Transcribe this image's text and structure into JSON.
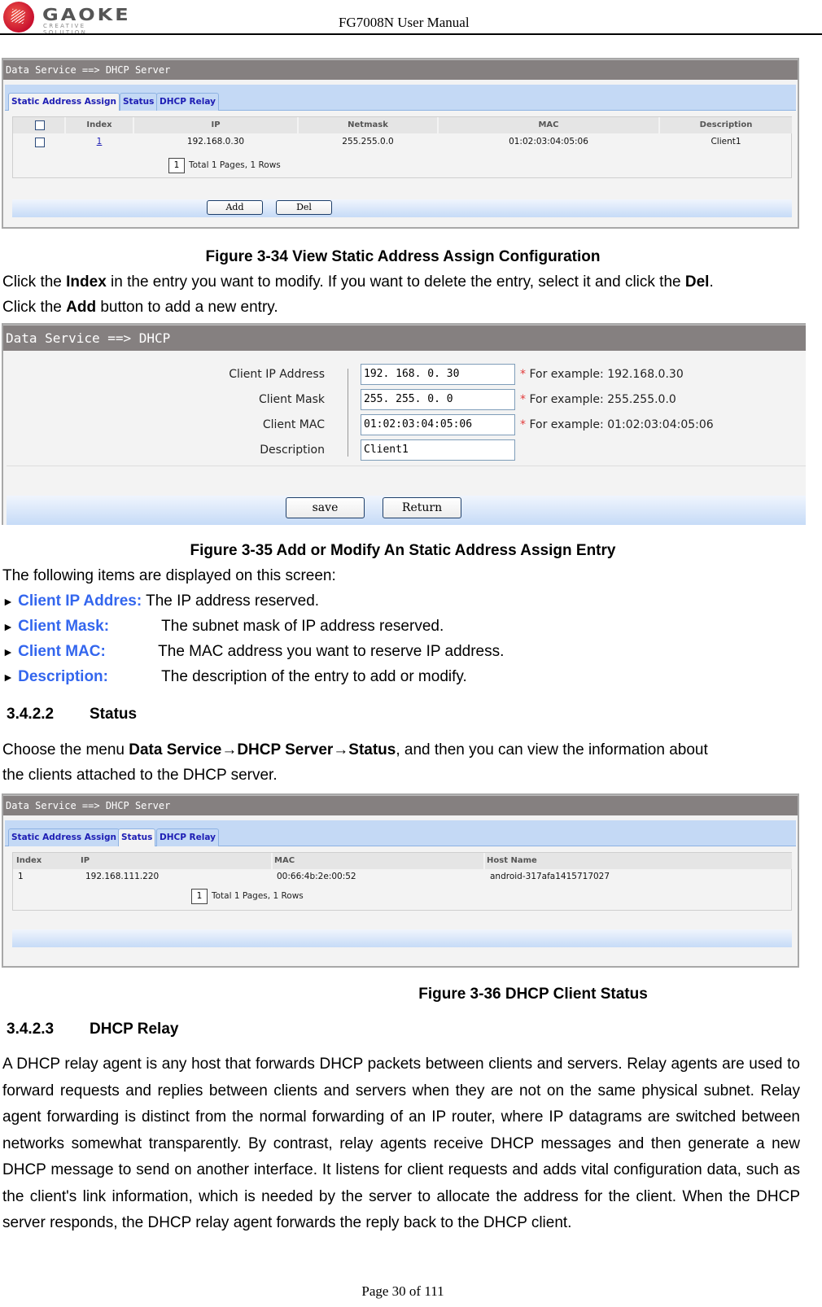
{
  "header": {
    "logo_word": "GAOKE",
    "logo_tagline": "CREATIVE SOLUTION",
    "doc_title": "FG7008N User Manual"
  },
  "fig34": {
    "title": "Data Service ==> DHCP Server",
    "tabs": [
      {
        "label": "Static Address Assign",
        "active": true
      },
      {
        "label": "Status",
        "active": false
      },
      {
        "label": "DHCP Relay",
        "active": false
      }
    ],
    "columns": [
      "Index",
      "IP",
      "Netmask",
      "MAC",
      "Description"
    ],
    "rows": [
      {
        "index": "1",
        "ip": "192.168.0.30",
        "netmask": "255.255.0.0",
        "mac": "01:02:03:04:05:06",
        "description": "Client1"
      }
    ],
    "pager_page": "1",
    "pager_text": "Total 1 Pages, 1 Rows",
    "add_label": "Add",
    "del_label": "Del",
    "caption": "Figure 3-34   View Static Address Assign Configuration"
  },
  "text1": {
    "line1_pre": "Click the ",
    "line1_b1": "Index",
    "line1_mid": " in the entry you want to modify. If you want to delete the entry, select it and click the ",
    "line1_b2": "Del",
    "line1_end": ".",
    "line2_pre": "Click the ",
    "line2_b": "Add",
    "line2_end": " button to add a new entry."
  },
  "fig35": {
    "title": "Data Service ==> DHCP",
    "fields": [
      {
        "label": "Client IP Address",
        "value": "192. 168. 0. 30",
        "hint": "For example: 192.168.0.30",
        "required": "*"
      },
      {
        "label": "Client Mask",
        "value": "255. 255. 0. 0",
        "hint": "For example: 255.255.0.0",
        "required": "*"
      },
      {
        "label": "Client MAC",
        "value": "01:02:03:04:05:06",
        "hint": "For example: 01:02:03:04:05:06",
        "required": "*"
      },
      {
        "label": "Description",
        "value": "Client1",
        "hint": "",
        "required": ""
      }
    ],
    "save_label": "save",
    "return_label": "Return",
    "caption": "Figure 3-35   Add or Modify An Static Address Assign Entry"
  },
  "items_intro": "The following items are displayed on this screen:",
  "items": [
    {
      "bullet": "►",
      "term": "Client IP Addres:",
      "desc": "The IP address reserved."
    },
    {
      "bullet": "►",
      "term": "Client Mask:",
      "desc": "The subnet mask of IP address reserved."
    },
    {
      "bullet": "►",
      "term": "Client MAC:",
      "desc": "The MAC address you want to reserve IP address."
    },
    {
      "bullet": "►",
      "term": "Description:",
      "desc": "The description of the entry to add or modify."
    }
  ],
  "sec_status": {
    "num": "3.4.2.2",
    "title": "Status",
    "p_pre": "Choose the menu ",
    "p_bold": "Data Service→DHCP Server→Status",
    "p_end": ", and then you can view the information about",
    "p_line2": "the clients attached to the DHCP server."
  },
  "fig36": {
    "title": "Data Service ==> DHCP Server",
    "tabs": [
      {
        "label": "Static Address Assign",
        "active": false
      },
      {
        "label": "Status",
        "active": true
      },
      {
        "label": "DHCP Relay",
        "active": false
      }
    ],
    "columns": [
      "Index",
      "IP",
      "MAC",
      "Host Name"
    ],
    "rows": [
      {
        "index": "1",
        "ip": "192.168.111.220",
        "mac": "00:66:4b:2e:00:52",
        "host": "android-317afa1415717027"
      }
    ],
    "pager_page": "1",
    "pager_text": "Total 1 Pages, 1 Rows",
    "caption": "Figure 3-36   DHCP Client Status"
  },
  "sec_relay": {
    "num": "3.4.2.3",
    "title": "DHCP Relay",
    "body": "A DHCP relay agent is any host that forwards DHCP packets between clients and servers. Relay agents are used to forward requests and replies between clients and servers when they are not on the same physical subnet. Relay agent forwarding is distinct from the normal forwarding of an IP router, where IP datagrams are switched between networks somewhat transparently. By contrast, relay agents receive DHCP messages and then generate a new DHCP message to send on another interface. It listens for client requests and adds vital configuration data, such as the client's link information, which is needed by the server to allocate the address for the client. When the DHCP server responds, the DHCP relay agent forwards the reply back to the DHCP client."
  },
  "footer": "Page 30 of 111"
}
